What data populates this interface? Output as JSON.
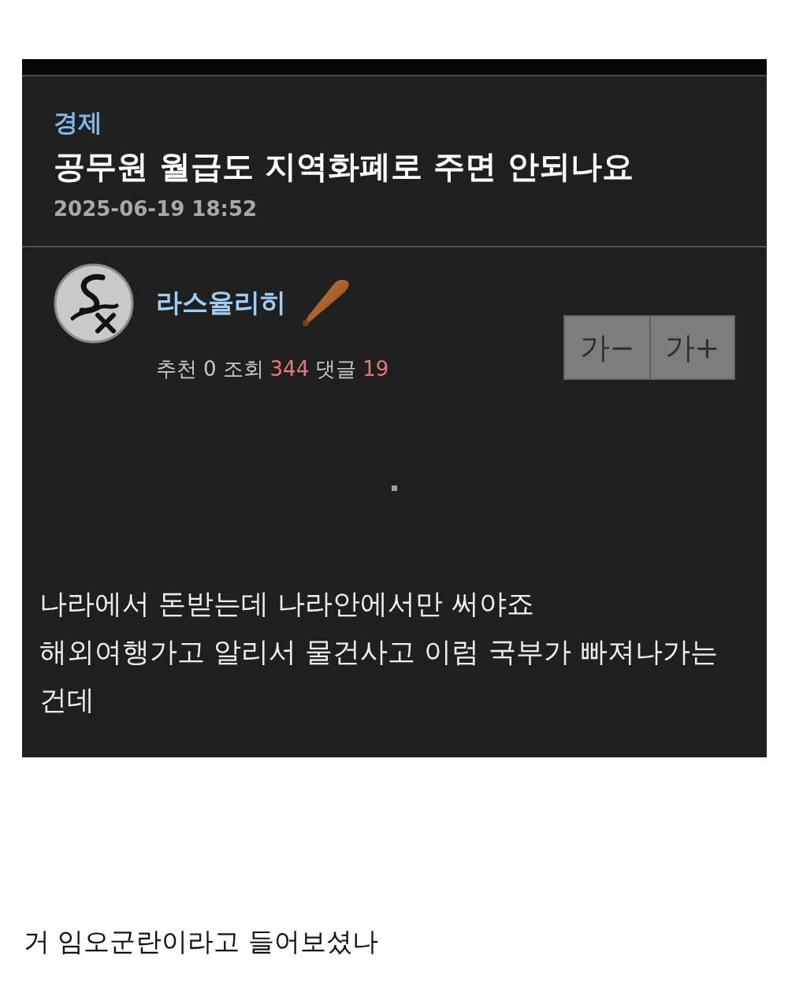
{
  "post": {
    "category": "경제",
    "title": "공무원 월급도 지역화폐로 주면 안되나요",
    "date": "2025-06-19 18:52"
  },
  "author": {
    "name": "라스율리히",
    "stats": [
      {
        "label": "추천",
        "value": "0",
        "color": "#c8c8c8"
      },
      {
        "label": "조회",
        "value": "344",
        "color": "#e87878"
      },
      {
        "label": "댓글",
        "value": "19",
        "color": "#e87878"
      }
    ]
  },
  "font_buttons": [
    "가−",
    "가+"
  ],
  "body": {
    "paragraphs": [
      "나라에서 돈받는데 나라안에서만 써야죠",
      "해외여행가고 알리서 물건사고 이럼 국부가 빠져나가는 건데"
    ]
  },
  "comment": "거 임오군란이라고 들어보셨나"
}
